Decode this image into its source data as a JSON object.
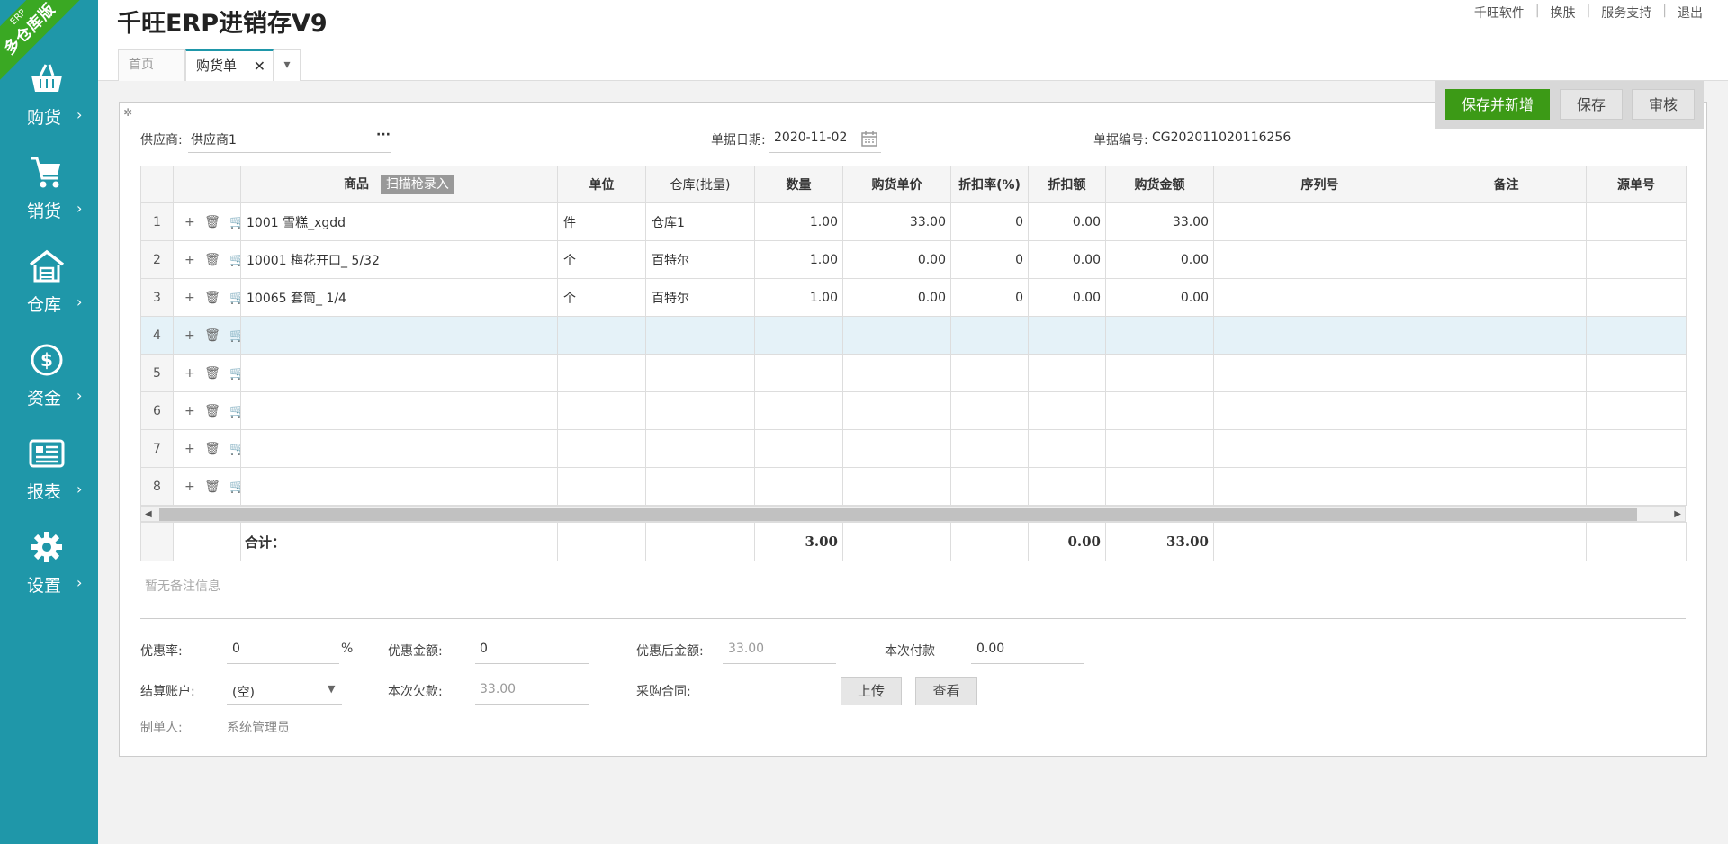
{
  "sidebar": {
    "ribbon_top": "ERP",
    "ribbon_main": "多仓库版",
    "items": [
      {
        "label": "购货",
        "icon": "basket-icon"
      },
      {
        "label": "销货",
        "icon": "cart-icon"
      },
      {
        "label": "仓库",
        "icon": "warehouse-icon"
      },
      {
        "label": "资金",
        "icon": "dollar-icon"
      },
      {
        "label": "报表",
        "icon": "report-icon"
      },
      {
        "label": "设置",
        "icon": "gear-icon"
      }
    ],
    "arrow": "›"
  },
  "header": {
    "title": "千旺ERP进销存V9",
    "links": [
      "千旺软件",
      "换肤",
      "服务支持",
      "退出"
    ]
  },
  "tabs": {
    "home": "首页",
    "purchase": "购货单",
    "close": "✕"
  },
  "toolbar": {
    "save_new": "保存并新增",
    "save": "保存",
    "audit": "审核"
  },
  "form": {
    "supplier_label": "供应商:",
    "supplier_value": "供应商1",
    "supplier_more": "···",
    "date_label": "单据日期:",
    "date_value": "2020-11-02",
    "number_label": "单据编号:",
    "number_value": "CG202011020116256"
  },
  "grid": {
    "headers": {
      "goods": "商品",
      "scan": "扫描枪录入",
      "unit": "单位",
      "warehouse": "仓库(批量)",
      "qty": "数量",
      "price": "购货单价",
      "discount_rate": "折扣率(%)",
      "discount_amount": "折扣额",
      "amount": "购货金额",
      "serial": "序列号",
      "note": "备注",
      "source": "源单号"
    },
    "ops": "+ 🗑 🛒",
    "rows": [
      {
        "n": "1",
        "goods": "1001 雪糕_xgdd",
        "unit": "件",
        "warehouse": "仓库1",
        "qty": "1.00",
        "price": "33.00",
        "rate": "0",
        "disc": "0.00",
        "amount": "33.00"
      },
      {
        "n": "2",
        "goods": "10001 梅花开口_  5/32",
        "unit": "个",
        "warehouse": "百特尔",
        "qty": "1.00",
        "price": "0.00",
        "rate": "0",
        "disc": "0.00",
        "amount": "0.00"
      },
      {
        "n": "3",
        "goods": "10065 套筒_  1/4",
        "unit": "个",
        "warehouse": "百特尔",
        "qty": "1.00",
        "price": "0.00",
        "rate": "0",
        "disc": "0.00",
        "amount": "0.00"
      },
      {
        "n": "4",
        "goods": "",
        "unit": "",
        "warehouse": "",
        "qty": "",
        "price": "",
        "rate": "",
        "disc": "",
        "amount": ""
      },
      {
        "n": "5",
        "goods": "",
        "unit": "",
        "warehouse": "",
        "qty": "",
        "price": "",
        "rate": "",
        "disc": "",
        "amount": ""
      },
      {
        "n": "6",
        "goods": "",
        "unit": "",
        "warehouse": "",
        "qty": "",
        "price": "",
        "rate": "",
        "disc": "",
        "amount": ""
      },
      {
        "n": "7",
        "goods": "",
        "unit": "",
        "warehouse": "",
        "qty": "",
        "price": "",
        "rate": "",
        "disc": "",
        "amount": ""
      },
      {
        "n": "8",
        "goods": "",
        "unit": "",
        "warehouse": "",
        "qty": "",
        "price": "",
        "rate": "",
        "disc": "",
        "amount": ""
      }
    ],
    "totals": {
      "label": "合计：",
      "qty": "3.00",
      "disc": "0.00",
      "amount": "33.00"
    }
  },
  "remark": {
    "placeholder": "暂无备注信息"
  },
  "footer": {
    "discount_rate_label": "优惠率:",
    "discount_rate_value": "0",
    "percent": "%",
    "discount_amount_label": "优惠金额:",
    "discount_amount_value": "0",
    "after_discount_label": "优惠后金额:",
    "after_discount_value": "33.00",
    "payment_label": "本次付款",
    "payment_value": "0.00",
    "account_label": "结算账户:",
    "account_value": "(空)",
    "debt_label": "本次欠款:",
    "debt_value": "33.00",
    "contract_label": "采购合同:",
    "upload": "上传",
    "view": "查看",
    "maker_label": "制单人:",
    "maker_value": "系统管理员"
  }
}
